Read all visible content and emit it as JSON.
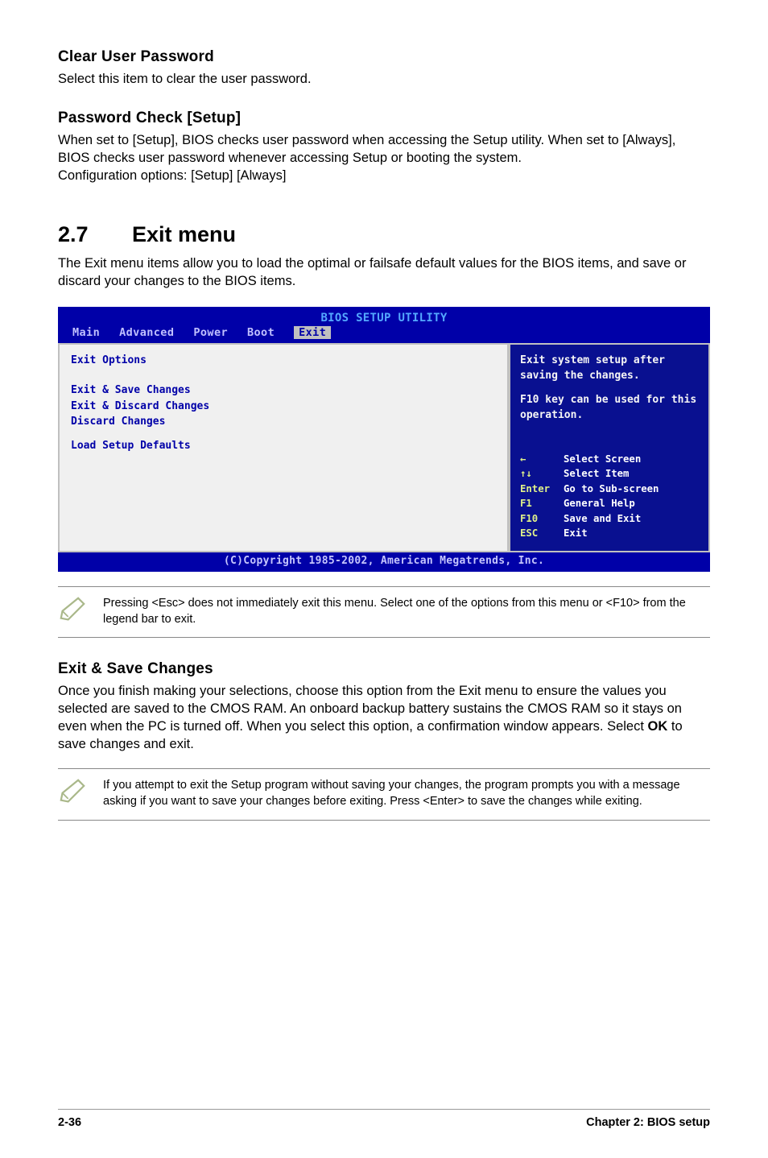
{
  "clear_password": {
    "heading": "Clear User Password",
    "text": "Select this item to clear the user password."
  },
  "password_check": {
    "heading": "Password Check [Setup]",
    "text": "When set to [Setup], BIOS checks user password when accessing the Setup utility. When set to [Always], BIOS checks user password whenever accessing Setup or booting the system.\nConfiguration options: [Setup] [Always]"
  },
  "chapter": {
    "number": "2.7",
    "title": "Exit menu",
    "intro": "The Exit menu items allow you to load the optimal or failsafe default values for the BIOS items, and save or discard your changes to the BIOS items."
  },
  "bios": {
    "title": "BIOS SETUP UTILITY",
    "tabs": {
      "main": "Main",
      "advanced": "Advanced",
      "power": "Power",
      "boot": "Boot",
      "exit": "Exit"
    },
    "left": {
      "options_title": "Exit Options",
      "item1": "Exit & Save Changes",
      "item2": "Exit & Discard Changes",
      "item3": "Discard Changes",
      "item4": "Load Setup Defaults"
    },
    "right": {
      "help1": "Exit system setup after saving the changes.",
      "help2": "F10 key can be used for this operation.",
      "keys": {
        "k1": "←",
        "v1": "Select Screen",
        "k2": "↑↓",
        "v2": "Select Item",
        "k3": "Enter",
        "v3": "Go to Sub-screen",
        "k4": "F1",
        "v4": "General Help",
        "k5": "F10",
        "v5": "Save and Exit",
        "k6": "ESC",
        "v6": "Exit"
      }
    },
    "footer": "(C)Copyright 1985-2002, American Megatrends, Inc."
  },
  "note1": "Pressing <Esc> does not immediately exit this menu. Select one of the options from this menu or <F10> from the legend bar to exit.",
  "exit_save": {
    "heading": "Exit & Save Changes",
    "text": "Once you finish making your selections, choose this option from the Exit menu to ensure the values you selected are saved to the CMOS RAM. An onboard backup battery sustains the CMOS RAM so it stays on even when the PC is turned off. When you select this option, a confirmation window appears. Select ",
    "ok": "OK",
    "text2": " to save changes and exit."
  },
  "note2": "If you attempt to exit the Setup program without saving your changes, the program prompts you with a message asking if you want to save your changes before exiting. Press <Enter> to save the changes while exiting.",
  "footer": {
    "left": "2-36",
    "right": "Chapter 2: BIOS setup"
  }
}
